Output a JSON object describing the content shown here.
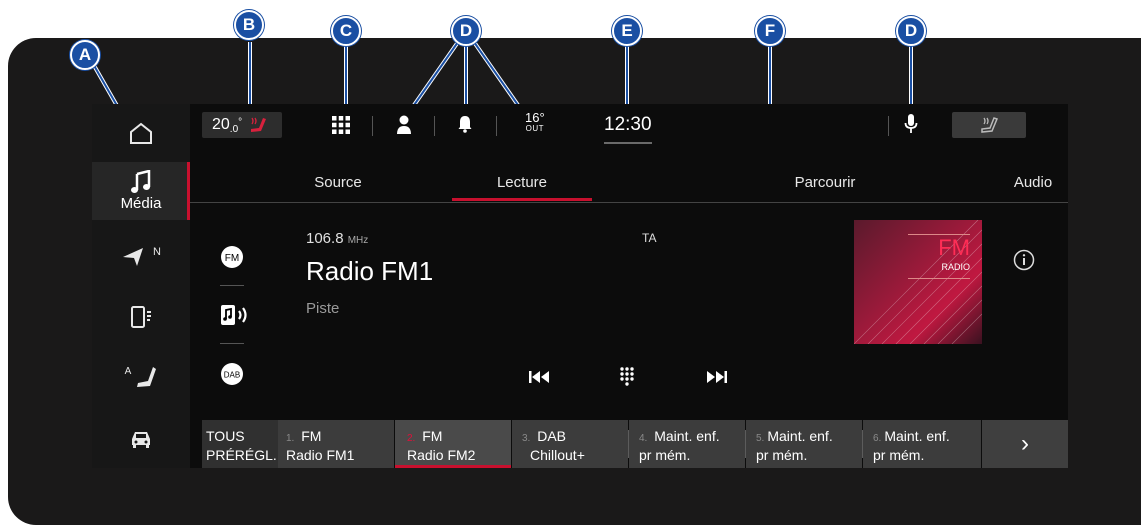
{
  "callouts": {
    "a": "A",
    "b": "B",
    "c": "C",
    "d1": "D",
    "e": "E",
    "f": "F",
    "d2": "D"
  },
  "nav": {
    "items": [
      {
        "name": "home",
        "icon": "home-icon"
      },
      {
        "name": "media",
        "icon": "music-note-icon",
        "label": "Média"
      },
      {
        "name": "navigation",
        "icon": "navigation-arrow-icon",
        "compass": "N"
      },
      {
        "name": "phone",
        "icon": "phone-icon"
      },
      {
        "name": "seat",
        "icon": "seat-icon",
        "prefix": "A"
      },
      {
        "name": "vehicle",
        "icon": "car-icon"
      }
    ]
  },
  "status": {
    "temperature": "20",
    "temperature_decimal": ".0",
    "temperature_unit": "°",
    "outside_temp": "16°",
    "outside_label": "OUT",
    "clock": "12:30"
  },
  "tabs": [
    "Source",
    "Lecture",
    "Parcourir",
    "Audio"
  ],
  "player": {
    "frequency": "106.8",
    "frequency_unit": "MHz",
    "ta": "TA",
    "station": "Radio FM1",
    "track": "Piste",
    "sources": [
      "FM",
      "DAB"
    ],
    "logo_fm": "FM",
    "logo_radio": "RADIO"
  },
  "presets": {
    "all_label_1": "TOUS",
    "all_label_2": "PRÉRÉGL.",
    "items": [
      {
        "num": "1.",
        "line1": "FM",
        "line2": "Radio FM1"
      },
      {
        "num": "2.",
        "line1": "FM",
        "line2": "Radio FM2"
      },
      {
        "num": "3.",
        "line1": "DAB",
        "line2": "Chillout+"
      },
      {
        "num": "4.",
        "line1": "Maint. enf.",
        "line2": "pr mém."
      },
      {
        "num": "5.",
        "line1": "Maint. enf.",
        "line2": "pr mém."
      },
      {
        "num": "6.",
        "line1": "Maint. enf.",
        "line2": "pr mém."
      }
    ],
    "next": "›"
  },
  "colors": {
    "accent": "#c8102e",
    "callout": "#1a4fa3",
    "bezel": "#1a1919",
    "screen": "#0c0c0c"
  }
}
